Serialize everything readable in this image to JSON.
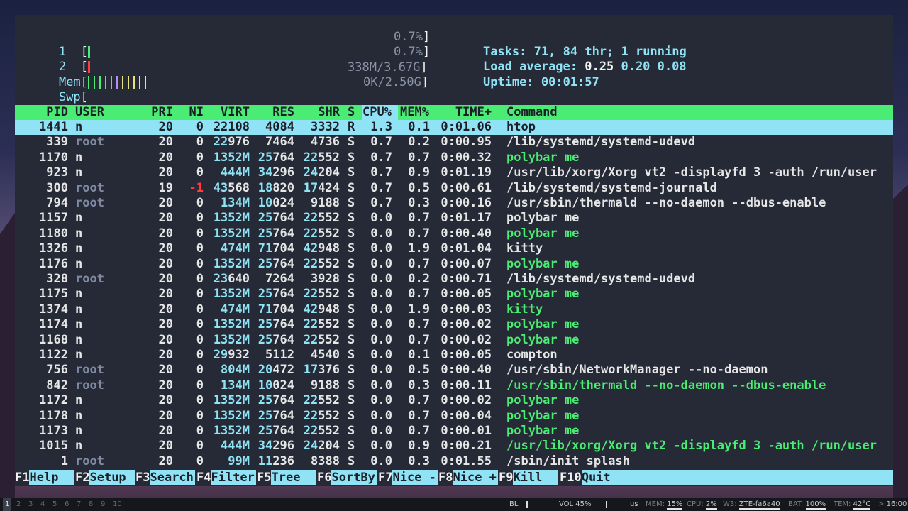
{
  "meters": {
    "cpu1": {
      "label": "1",
      "bracket_open": "[",
      "bracket_close": "]",
      "value": "0.7%",
      "level": 0.007
    },
    "cpu2": {
      "label": "2",
      "bracket_open": "[",
      "bracket_close": "]",
      "value": "0.7%",
      "level": 0.007
    },
    "mem": {
      "label": "Mem",
      "bracket_open": "[",
      "bracket_close": "]",
      "value": "338M/3.67G",
      "level": 0.09
    },
    "swp": {
      "label": "Swp",
      "bracket_open": "[",
      "bracket_close": "]",
      "value": "0K/2.50G",
      "level": 0
    }
  },
  "stats": {
    "tasks_label": "Tasks:",
    "tasks": "71,",
    "thr": "84",
    "thr_label": "thr;",
    "running": "1",
    "running_label": "running",
    "load_label": "Load average:",
    "load1": "0.25",
    "load5": "0.20",
    "load15": "0.08",
    "uptime_label": "Uptime:",
    "uptime": "00:01:57"
  },
  "columns": [
    "PID",
    "USER",
    "PRI",
    "NI",
    "VIRT",
    "RES",
    "SHR",
    "S",
    "CPU%",
    "MEM%",
    "TIME+",
    "Command"
  ],
  "processes": [
    {
      "pid": "1441",
      "user": "n",
      "pri": "20",
      "ni": "0",
      "virt": "22108",
      "res": "4084",
      "shr": "3332",
      "s": "R",
      "cpu": "1.3",
      "mem": "0.1",
      "time": "0:01.06",
      "cmd": "htop"
    },
    {
      "pid": "339",
      "user": "root",
      "pri": "20",
      "ni": "0",
      "virt": "22976",
      "res": "7464",
      "shr": "4736",
      "s": "S",
      "cpu": "0.7",
      "mem": "0.2",
      "time": "0:00.95",
      "cmd": "/lib/systemd/systemd-udevd"
    },
    {
      "pid": "1170",
      "user": "n",
      "pri": "20",
      "ni": "0",
      "virt": "1352M",
      "res": "25764",
      "shr": "22552",
      "s": "S",
      "cpu": "0.7",
      "mem": "0.7",
      "time": "0:00.32",
      "cmd": "polybar me"
    },
    {
      "pid": "923",
      "user": "n",
      "pri": "20",
      "ni": "0",
      "virt": "444M",
      "res": "34296",
      "shr": "24204",
      "s": "S",
      "cpu": "0.7",
      "mem": "0.9",
      "time": "0:01.19",
      "cmd": "/usr/lib/xorg/Xorg vt2 -displayfd 3 -auth /run/user"
    },
    {
      "pid": "300",
      "user": "root",
      "pri": "19",
      "ni": "-1",
      "virt": "43568",
      "res": "18820",
      "shr": "17424",
      "s": "S",
      "cpu": "0.7",
      "mem": "0.5",
      "time": "0:00.61",
      "cmd": "/lib/systemd/systemd-journald"
    },
    {
      "pid": "794",
      "user": "root",
      "pri": "20",
      "ni": "0",
      "virt": "134M",
      "res": "10024",
      "shr": "9188",
      "s": "S",
      "cpu": "0.7",
      "mem": "0.3",
      "time": "0:00.16",
      "cmd": "/usr/sbin/thermald --no-daemon --dbus-enable"
    },
    {
      "pid": "1157",
      "user": "n",
      "pri": "20",
      "ni": "0",
      "virt": "1352M",
      "res": "25764",
      "shr": "22552",
      "s": "S",
      "cpu": "0.0",
      "mem": "0.7",
      "time": "0:01.17",
      "cmd": "polybar me"
    },
    {
      "pid": "1180",
      "user": "n",
      "pri": "20",
      "ni": "0",
      "virt": "1352M",
      "res": "25764",
      "shr": "22552",
      "s": "S",
      "cpu": "0.0",
      "mem": "0.7",
      "time": "0:00.40",
      "cmd": "polybar me"
    },
    {
      "pid": "1326",
      "user": "n",
      "pri": "20",
      "ni": "0",
      "virt": "474M",
      "res": "71704",
      "shr": "42948",
      "s": "S",
      "cpu": "0.0",
      "mem": "1.9",
      "time": "0:01.04",
      "cmd": "kitty"
    },
    {
      "pid": "1176",
      "user": "n",
      "pri": "20",
      "ni": "0",
      "virt": "1352M",
      "res": "25764",
      "shr": "22552",
      "s": "S",
      "cpu": "0.0",
      "mem": "0.7",
      "time": "0:00.07",
      "cmd": "polybar me"
    },
    {
      "pid": "328",
      "user": "root",
      "pri": "20",
      "ni": "0",
      "virt": "23640",
      "res": "7264",
      "shr": "3928",
      "s": "S",
      "cpu": "0.0",
      "mem": "0.2",
      "time": "0:00.71",
      "cmd": "/lib/systemd/systemd-udevd"
    },
    {
      "pid": "1175",
      "user": "n",
      "pri": "20",
      "ni": "0",
      "virt": "1352M",
      "res": "25764",
      "shr": "22552",
      "s": "S",
      "cpu": "0.0",
      "mem": "0.7",
      "time": "0:00.05",
      "cmd": "polybar me"
    },
    {
      "pid": "1374",
      "user": "n",
      "pri": "20",
      "ni": "0",
      "virt": "474M",
      "res": "71704",
      "shr": "42948",
      "s": "S",
      "cpu": "0.0",
      "mem": "1.9",
      "time": "0:00.03",
      "cmd": "kitty"
    },
    {
      "pid": "1174",
      "user": "n",
      "pri": "20",
      "ni": "0",
      "virt": "1352M",
      "res": "25764",
      "shr": "22552",
      "s": "S",
      "cpu": "0.0",
      "mem": "0.7",
      "time": "0:00.02",
      "cmd": "polybar me"
    },
    {
      "pid": "1168",
      "user": "n",
      "pri": "20",
      "ni": "0",
      "virt": "1352M",
      "res": "25764",
      "shr": "22552",
      "s": "S",
      "cpu": "0.0",
      "mem": "0.7",
      "time": "0:00.02",
      "cmd": "polybar me"
    },
    {
      "pid": "1122",
      "user": "n",
      "pri": "20",
      "ni": "0",
      "virt": "29932",
      "res": "5112",
      "shr": "4540",
      "s": "S",
      "cpu": "0.0",
      "mem": "0.1",
      "time": "0:00.05",
      "cmd": "compton"
    },
    {
      "pid": "756",
      "user": "root",
      "pri": "20",
      "ni": "0",
      "virt": "804M",
      "res": "20472",
      "shr": "17376",
      "s": "S",
      "cpu": "0.0",
      "mem": "0.5",
      "time": "0:00.40",
      "cmd": "/usr/sbin/NetworkManager --no-daemon"
    },
    {
      "pid": "842",
      "user": "root",
      "pri": "20",
      "ni": "0",
      "virt": "134M",
      "res": "10024",
      "shr": "9188",
      "s": "S",
      "cpu": "0.0",
      "mem": "0.3",
      "time": "0:00.11",
      "cmd": "/usr/sbin/thermald --no-daemon --dbus-enable"
    },
    {
      "pid": "1172",
      "user": "n",
      "pri": "20",
      "ni": "0",
      "virt": "1352M",
      "res": "25764",
      "shr": "22552",
      "s": "S",
      "cpu": "0.0",
      "mem": "0.7",
      "time": "0:00.02",
      "cmd": "polybar me"
    },
    {
      "pid": "1178",
      "user": "n",
      "pri": "20",
      "ni": "0",
      "virt": "1352M",
      "res": "25764",
      "shr": "22552",
      "s": "S",
      "cpu": "0.0",
      "mem": "0.7",
      "time": "0:00.04",
      "cmd": "polybar me"
    },
    {
      "pid": "1173",
      "user": "n",
      "pri": "20",
      "ni": "0",
      "virt": "1352M",
      "res": "25764",
      "shr": "22552",
      "s": "S",
      "cpu": "0.0",
      "mem": "0.7",
      "time": "0:00.01",
      "cmd": "polybar me"
    },
    {
      "pid": "1015",
      "user": "n",
      "pri": "20",
      "ni": "0",
      "virt": "444M",
      "res": "34296",
      "shr": "24204",
      "s": "S",
      "cpu": "0.0",
      "mem": "0.9",
      "time": "0:00.21",
      "cmd": "/usr/lib/xorg/Xorg vt2 -displayfd 3 -auth /run/user"
    },
    {
      "pid": "1",
      "user": "root",
      "pri": "20",
      "ni": "0",
      "virt": "99M",
      "res": "11236",
      "shr": "8388",
      "s": "S",
      "cpu": "0.0",
      "mem": "0.3",
      "time": "0:01.55",
      "cmd": "/sbin/init splash"
    }
  ],
  "fkeys": [
    {
      "key": "F1",
      "label": "Help"
    },
    {
      "key": "F2",
      "label": "Setup"
    },
    {
      "key": "F3",
      "label": "Search"
    },
    {
      "key": "F4",
      "label": "Filter"
    },
    {
      "key": "F5",
      "label": "Tree"
    },
    {
      "key": "F6",
      "label": "SortBy"
    },
    {
      "key": "F7",
      "label": "Nice -"
    },
    {
      "key": "F8",
      "label": "Nice +"
    },
    {
      "key": "F9",
      "label": "Kill"
    },
    {
      "key": "F10",
      "label": "Quit"
    }
  ],
  "statusbar": {
    "workspaces": [
      "1",
      "2",
      "3",
      "4",
      "5",
      "6",
      "7",
      "8",
      "9",
      "10"
    ],
    "bl_label": "BL",
    "vol_label": "VOL 45%",
    "us": "us",
    "mem_label": "MEM:",
    "mem": "15%",
    "cpu_label": "CPU:",
    "cpu": "2%",
    "w3_label": "W3:",
    "w3": "ZTE-fa6a40",
    "bat_label": "BAT:",
    "bat": "100%",
    "tem_label": "TEM:",
    "tem": "42°C",
    "arrow": ">",
    "time": "16:00"
  },
  "colors": {
    "green": "#4bec74",
    "cyan": "#8fe3f5",
    "red": "#ff3b3b",
    "bg": "#252a36"
  }
}
